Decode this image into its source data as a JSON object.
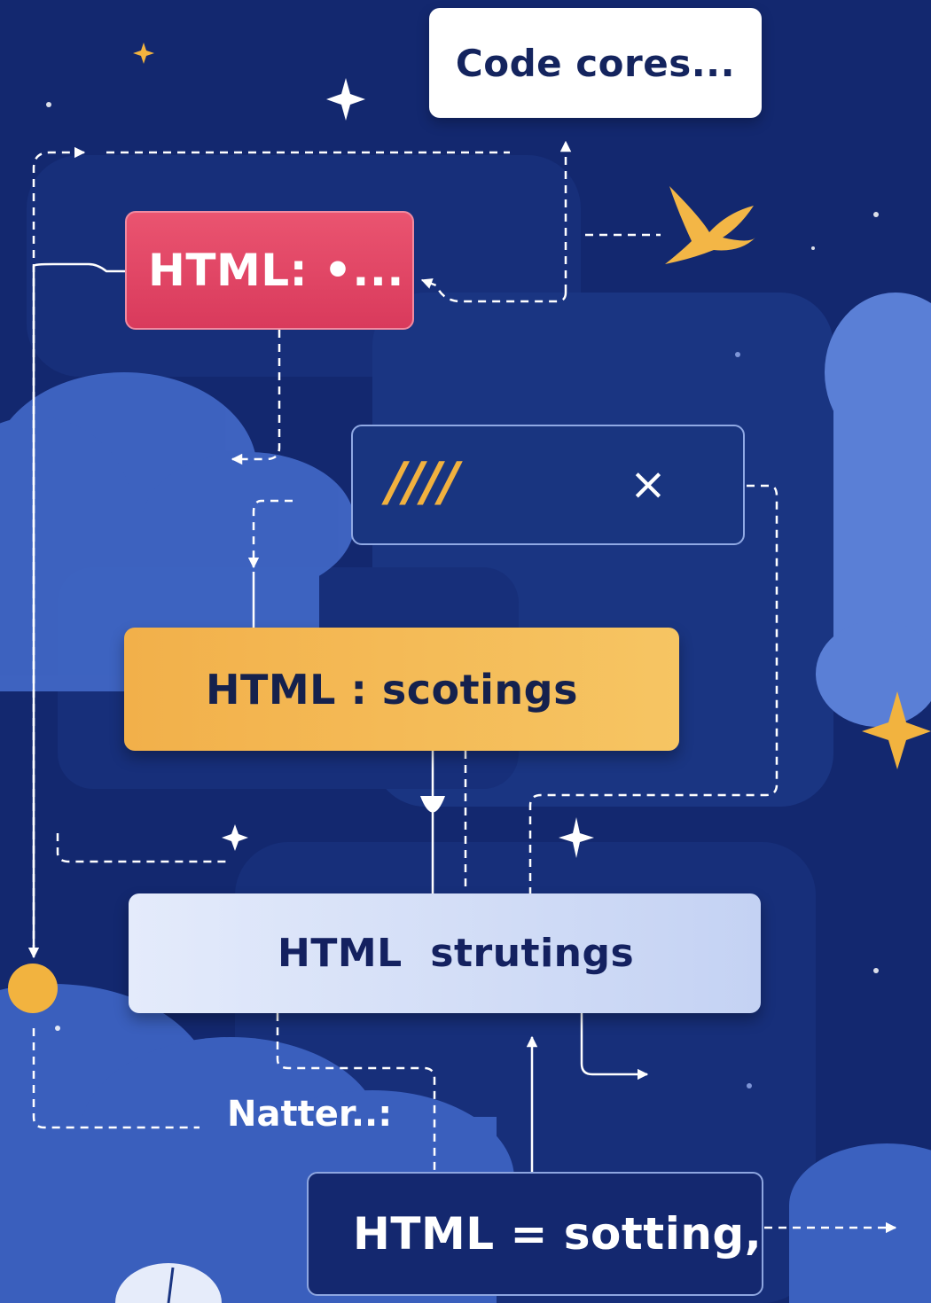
{
  "diagram": {
    "nodes": {
      "code_cores": {
        "label": "Code cores..."
      },
      "html_red": {
        "label": "HTML: •..."
      },
      "slash_box": {
        "mark": "////",
        "close": "×"
      },
      "html_yellow": {
        "label": "HTML : scotings"
      },
      "html_light": {
        "label": "HTML  strutings"
      },
      "natter": {
        "label": "Natter..:"
      },
      "html_dark": {
        "label": "HTML = sotting,"
      }
    }
  },
  "colors": {
    "background": "#13286f",
    "red_node": "#e04a67",
    "yellow_node": "#f3b853",
    "accent_gold": "#f1b13f",
    "light_node": "#d6e0f7",
    "dark_node": "#14286f",
    "cloud_blue": "#3f64c2",
    "connector": "#ffffff"
  },
  "icons": [
    "sparkle-icon",
    "bird-icon",
    "close-icon",
    "arrow-icon",
    "dot-icon"
  ]
}
